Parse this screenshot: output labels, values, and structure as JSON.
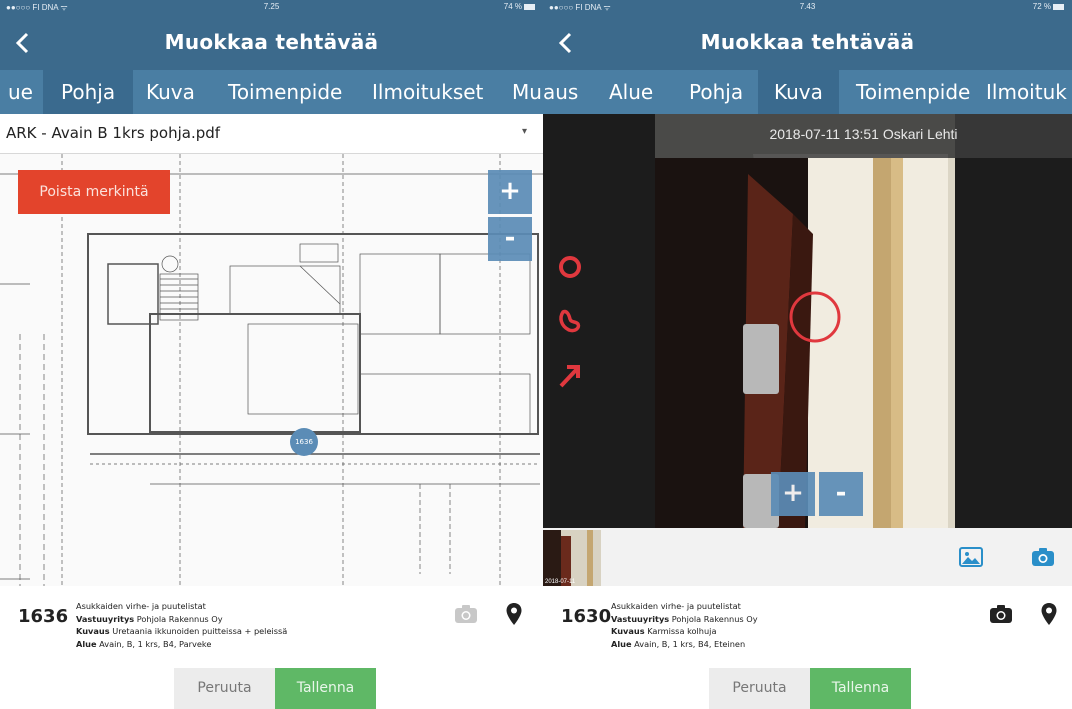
{
  "left": {
    "status": {
      "carrier": "●●○○○ FI DNA ᯤ",
      "time": "7.25",
      "battery": "74 %"
    },
    "nav": {
      "title": "Muokkaa tehtävää"
    },
    "tabs": [
      "ue",
      "Pohja",
      "Kuva",
      "Toimenpide",
      "Ilmoitukset",
      "Mu"
    ],
    "active_tab": "Pohja",
    "file_select": {
      "value": "ARK - Avain B 1krs pohja.pdf"
    },
    "delete_button": "Poista merkintä",
    "zoom": {
      "in": "+",
      "out": "-"
    },
    "marker": {
      "label": "1636"
    },
    "task": {
      "id": "1636",
      "category": "Asukkaiden virhe- ja puutelistat",
      "company_label": "Vastuuyritys",
      "company": "Pohjola Rakennus Oy",
      "description_label": "Kuvaus",
      "description": "Uretaania ikkunoiden puitteissa + peleissä",
      "area_label": "Alue",
      "area": "Avain, B, 1 krs, B4, Parveke"
    },
    "buttons": {
      "cancel": "Peruuta",
      "save": "Tallenna"
    }
  },
  "right": {
    "status": {
      "carrier": "●●○○○ FI DNA ᯤ",
      "time": "7.43",
      "battery": "72 %"
    },
    "nav": {
      "title": "Muokkaa tehtävää"
    },
    "tabs": [
      "aus",
      "Alue",
      "Pohja",
      "Kuva",
      "Toimenpide",
      "Ilmoituk"
    ],
    "active_tab": "Kuva",
    "photo": {
      "caption": "2018-07-11 13:51 Oskari Lehti"
    },
    "tools": [
      "circle-tool-icon",
      "freehand-tool-icon",
      "arrow-tool-icon"
    ],
    "zoom": {
      "in": "+",
      "out": "-"
    },
    "thumbnail": {
      "date": "2018-07-11"
    },
    "task": {
      "id": "1630",
      "category": "Asukkaiden virhe- ja puutelistat",
      "company_label": "Vastuuyritys",
      "company": "Pohjola Rakennus Oy",
      "description_label": "Kuvaus",
      "description": "Karmissa kolhuja",
      "area_label": "Alue",
      "area": "Avain, B, 1 krs, B4, Eteinen"
    },
    "buttons": {
      "cancel": "Peruuta",
      "save": "Tallenna"
    }
  },
  "colors": {
    "nav": "#3c6a8c",
    "tabs": "#4a7ea3",
    "accent": "#5b8cb6",
    "danger": "#e3442c",
    "success": "#5fb866",
    "annotation": "#e0383e"
  }
}
